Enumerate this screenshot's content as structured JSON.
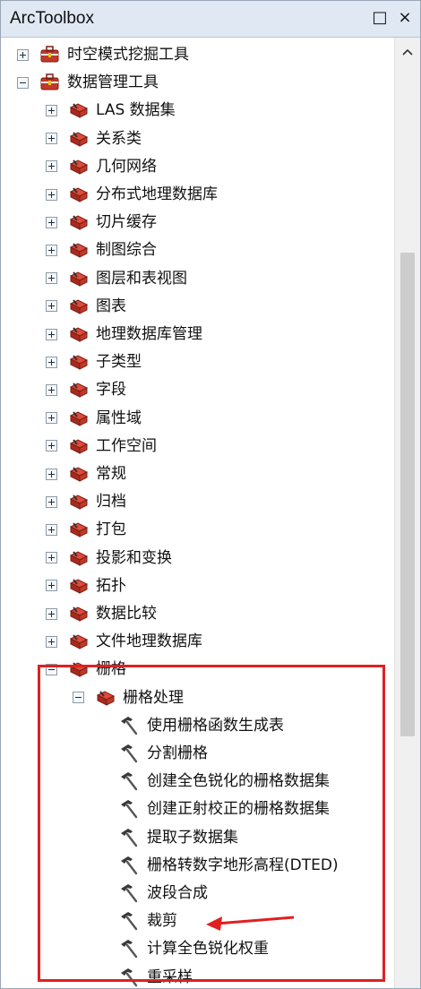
{
  "window": {
    "title": "ArcToolbox",
    "restore_glyph": "□",
    "close_glyph": "×"
  },
  "tree": {
    "items": [
      {
        "level": 0,
        "state": "plus",
        "kind": "toolbox",
        "label": "时空模式挖掘工具"
      },
      {
        "level": 0,
        "state": "minus",
        "kind": "toolbox",
        "label": "数据管理工具"
      },
      {
        "level": 1,
        "state": "plus",
        "kind": "toolset",
        "label": "LAS 数据集"
      },
      {
        "level": 1,
        "state": "plus",
        "kind": "toolset",
        "label": "关系类"
      },
      {
        "level": 1,
        "state": "plus",
        "kind": "toolset",
        "label": "几何网络"
      },
      {
        "level": 1,
        "state": "plus",
        "kind": "toolset",
        "label": "分布式地理数据库"
      },
      {
        "level": 1,
        "state": "plus",
        "kind": "toolset",
        "label": "切片缓存"
      },
      {
        "level": 1,
        "state": "plus",
        "kind": "toolset",
        "label": "制图综合"
      },
      {
        "level": 1,
        "state": "plus",
        "kind": "toolset",
        "label": "图层和表视图"
      },
      {
        "level": 1,
        "state": "plus",
        "kind": "toolset",
        "label": "图表"
      },
      {
        "level": 1,
        "state": "plus",
        "kind": "toolset",
        "label": "地理数据库管理"
      },
      {
        "level": 1,
        "state": "plus",
        "kind": "toolset",
        "label": "子类型"
      },
      {
        "level": 1,
        "state": "plus",
        "kind": "toolset",
        "label": "字段"
      },
      {
        "level": 1,
        "state": "plus",
        "kind": "toolset",
        "label": "属性域"
      },
      {
        "level": 1,
        "state": "plus",
        "kind": "toolset",
        "label": "工作空间"
      },
      {
        "level": 1,
        "state": "plus",
        "kind": "toolset",
        "label": "常规"
      },
      {
        "level": 1,
        "state": "plus",
        "kind": "toolset",
        "label": "归档"
      },
      {
        "level": 1,
        "state": "plus",
        "kind": "toolset",
        "label": "打包"
      },
      {
        "level": 1,
        "state": "plus",
        "kind": "toolset",
        "label": "投影和变换"
      },
      {
        "level": 1,
        "state": "plus",
        "kind": "toolset",
        "label": "拓扑"
      },
      {
        "level": 1,
        "state": "plus",
        "kind": "toolset",
        "label": "数据比较"
      },
      {
        "level": 1,
        "state": "plus",
        "kind": "toolset",
        "label": "文件地理数据库"
      },
      {
        "level": 1,
        "state": "minus",
        "kind": "toolset",
        "label": "栅格"
      },
      {
        "level": 2,
        "state": "minus",
        "kind": "toolset",
        "label": "栅格处理"
      },
      {
        "level": 3,
        "state": "none",
        "kind": "tool",
        "label": "使用栅格函数生成表"
      },
      {
        "level": 3,
        "state": "none",
        "kind": "tool",
        "label": "分割栅格"
      },
      {
        "level": 3,
        "state": "none",
        "kind": "tool",
        "label": "创建全色锐化的栅格数据集"
      },
      {
        "level": 3,
        "state": "none",
        "kind": "tool",
        "label": "创建正射校正的栅格数据集"
      },
      {
        "level": 3,
        "state": "none",
        "kind": "tool",
        "label": "提取子数据集"
      },
      {
        "level": 3,
        "state": "none",
        "kind": "tool",
        "label": "栅格转数字地形高程(DTED)"
      },
      {
        "level": 3,
        "state": "none",
        "kind": "tool",
        "label": "波段合成"
      },
      {
        "level": 3,
        "state": "none",
        "kind": "tool",
        "label": "裁剪"
      },
      {
        "level": 3,
        "state": "none",
        "kind": "tool",
        "label": "计算全色锐化权重"
      },
      {
        "level": 3,
        "state": "none",
        "kind": "tool",
        "label": "重采样"
      }
    ]
  },
  "colors": {
    "highlight": "#e02020",
    "arrow": "#e02020",
    "toolbox_red": "#c0392b"
  }
}
